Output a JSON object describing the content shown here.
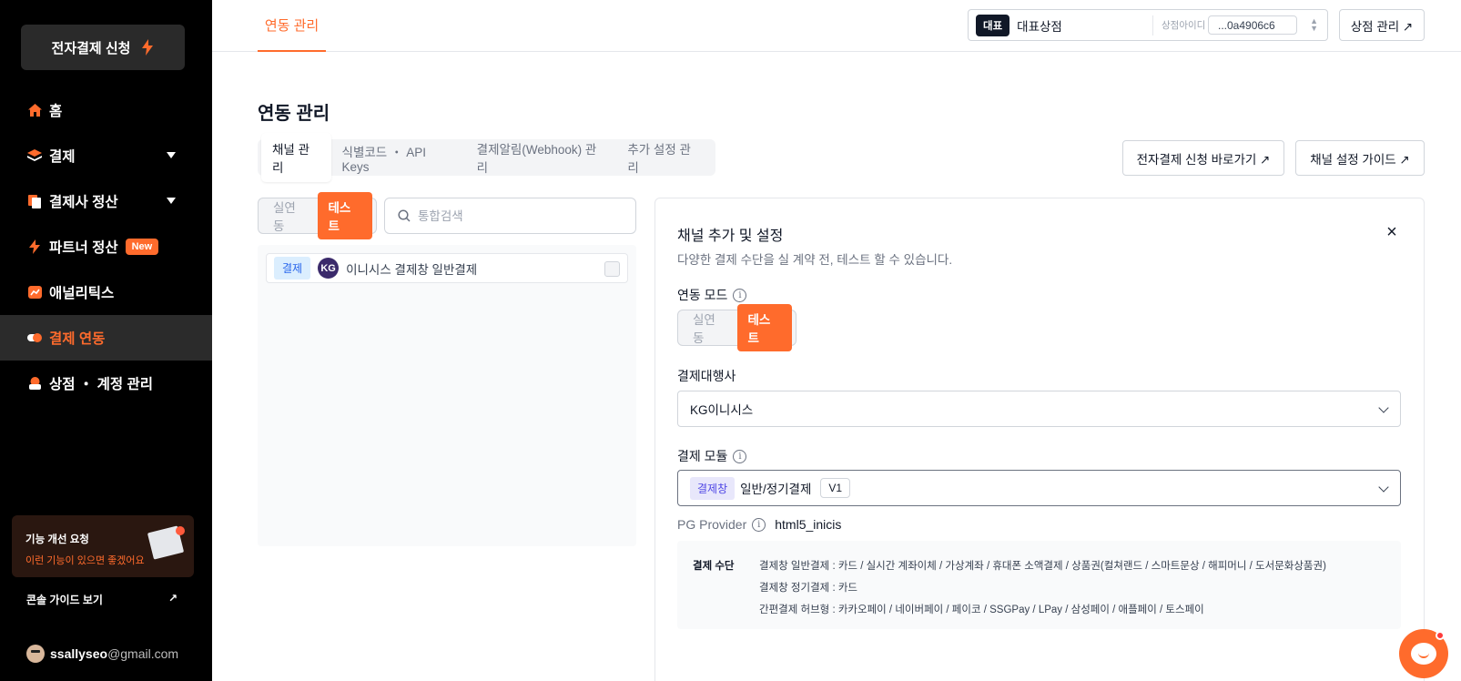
{
  "sidebar": {
    "apply_label": "전자결제 신청",
    "items": [
      {
        "label": "홈",
        "icon": "home-icon",
        "caret": false,
        "active": false
      },
      {
        "label": "결제",
        "icon": "payment-stack-icon",
        "caret": true,
        "active": false
      },
      {
        "label": "결제사 정산",
        "icon": "document-icon",
        "caret": true,
        "active": false
      },
      {
        "label": "파트너 정산",
        "icon": "lightning-icon",
        "caret": false,
        "active": false,
        "badge": "New"
      },
      {
        "label": "애널리틱스",
        "icon": "chart-icon",
        "caret": false,
        "active": false
      },
      {
        "label": "결제 연동",
        "icon": "pill-icon",
        "caret": false,
        "active": true
      },
      {
        "label": "상점 ・ 계정 관리",
        "icon": "store-icon",
        "caret": false,
        "active": false
      }
    ],
    "feedback": {
      "title": "기능 개선 요청",
      "subtitle": "이런 기능이 있으면 좋겠어요"
    },
    "guide_label": "콘솔 가이드 보기",
    "user": {
      "name": "ssallyseo",
      "domain": "@gmail.com"
    }
  },
  "topbar": {
    "tab_label": "연동 관리",
    "store": {
      "pill": "대표",
      "name": "대표상점",
      "id_label": "상점아이디",
      "id_value": "...0a4906c6"
    },
    "manage_label": "상점 관리 ↗"
  },
  "main": {
    "title": "연동 관리",
    "tabs": [
      "채널 관리",
      "식별코드 ・ API Keys",
      "결제알림(Webhook) 관리",
      "추가 설정 관리"
    ],
    "apply_shortcut": "전자결제 신청 바로가기 ↗",
    "guide": "채널 설정 가이드 ↗",
    "mode_toggle": {
      "live": "실연동",
      "test": "테스트",
      "selected": "test"
    },
    "search_placeholder": "통합검색",
    "channels": [
      {
        "tag": "결제",
        "logo": "KG",
        "name": "이니시스 결제창 일반결제"
      }
    ]
  },
  "detail": {
    "title": "채널 추가 및 설정",
    "subtitle": "다양한 결제 수단을 실 계약 전, 테스트 할 수 있습니다.",
    "mode_label": "연동 모드",
    "mode": {
      "live": "실연동",
      "test": "테스트",
      "selected": "test"
    },
    "pg_label": "결제대행사",
    "pg_value": "KG이니시스",
    "module_label": "결제 모듈",
    "module": {
      "tag": "결제창",
      "value": "일반/정기결제",
      "version": "V1"
    },
    "provider_label": "PG Provider",
    "provider_value": "html5_inicis",
    "methods_label": "결제 수단",
    "methods": [
      "결제창 일반결제 : 카드 / 실시간 계좌이체 / 가상계좌 / 휴대폰 소액결제 / 상품권(컬쳐랜드 / 스마트문상 / 해피머니 / 도서문화상품권)",
      "결제창 정기결제 : 카드",
      "간편결제 허브형 : 카카오페이 / 네이버페이 / 페이코 / SSGPay / LPay / 삼성페이 / 애플페이 / 토스페이"
    ]
  },
  "colors": {
    "accent": "#ff6b2c",
    "sidebar_bg": "#000000"
  }
}
